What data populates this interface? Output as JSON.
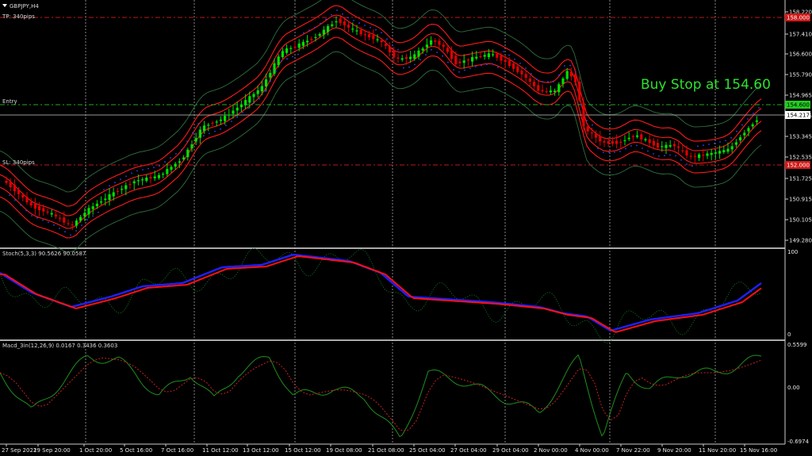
{
  "header": {
    "symbol": "GBPJPY,H4",
    "tp_label": "TP: 340pips",
    "entry_label": "Entry",
    "sl_label": "SL: 340pips",
    "annotation": "Buy Stop at 154.60"
  },
  "price_axis": {
    "ticks": [
      "158.220",
      "157.410",
      "156.600",
      "155.790",
      "154.965",
      "154.155",
      "153.345",
      "152.535",
      "151.725",
      "150.915",
      "150.105",
      "149.280"
    ],
    "tp_tag": "158.000",
    "entry_tag": "154.600",
    "current_tag": "154.217",
    "sl_tag": "152.000"
  },
  "stoch": {
    "label": "Stoch(5,3,3) 90.5626 90.0587",
    "ticks": [
      "100",
      "0"
    ]
  },
  "macd": {
    "label": "Macd_3in(12,26,9) 0.0167 0.3436 0.3603",
    "ticks": [
      "0.5599",
      "0.00",
      "-0.6974"
    ]
  },
  "time_axis": {
    "ticks": [
      "27 Sep 2021",
      "29 Sep 20:00",
      "1 Oct 20:00",
      "5 Oct 16:00",
      "7 Oct 16:00",
      "11 Oct 12:00",
      "13 Oct 12:00",
      "15 Oct 12:00",
      "19 Oct 08:00",
      "21 Oct 08:00",
      "25 Oct 04:00",
      "27 Oct 04:00",
      "29 Oct 04:00",
      "2 Nov 00:00",
      "4 Nov 00:00",
      "7 Nov 22:00",
      "9 Nov 20:00",
      "11 Nov 20:00",
      "15 Nov 16:00"
    ]
  },
  "colors": {
    "background": "#000000",
    "bull": "#00e000",
    "bear": "#e00000",
    "envelope": "#ff1a1a",
    "bollinger": "#2f6f3f",
    "psar": "#2f40ff",
    "tp_line": "#c01818",
    "entry_line": "#22aa22",
    "stoch_main": "#2020ff",
    "stoch_signal": "#ff1010",
    "macd_main": "#1f8f1f",
    "macd_signal": "#c82020",
    "grid": "#d0d0d0"
  }
}
